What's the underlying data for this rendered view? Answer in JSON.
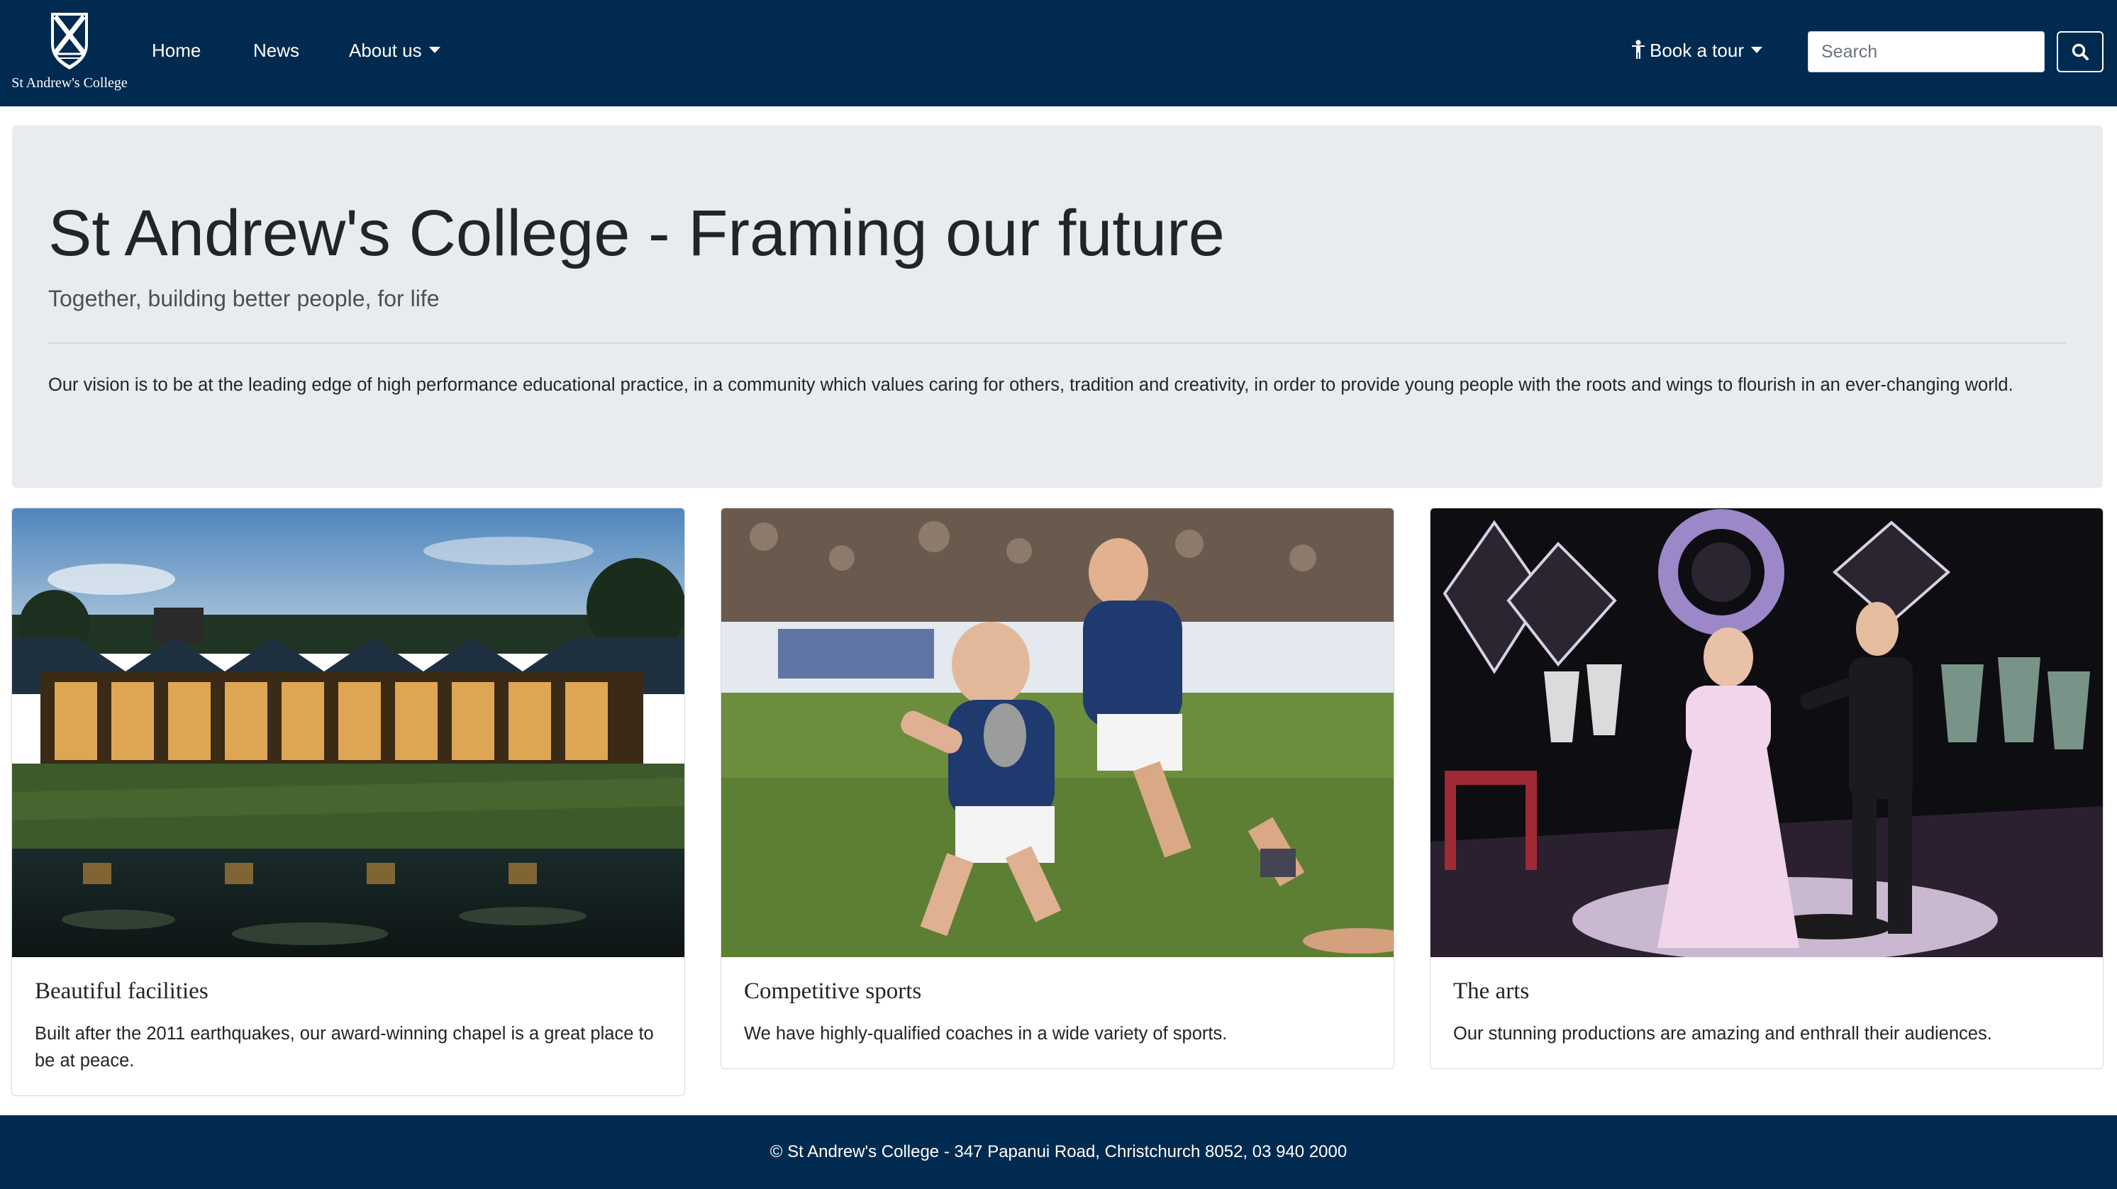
{
  "navbar": {
    "brand_text": "St Andrew's College",
    "links": [
      {
        "label": "Home"
      },
      {
        "label": "News"
      },
      {
        "label": "About us"
      }
    ],
    "book_tour_label": "Book a tour",
    "search_placeholder": "Search"
  },
  "jumbotron": {
    "title": "St Andrew's College - Framing our future",
    "lead": "Together, building better people, for life",
    "vision": "Our vision is to be at the leading edge of high performance educational practice, in a community which values caring for others, tradition and creativity, in order to provide young people with the roots and wings to flourish in an ever-changing world."
  },
  "cards": [
    {
      "title": "Beautiful facilities",
      "text": "Built after the 2011 earthquakes, our award-winning chapel is a great place to be at peace."
    },
    {
      "title": "Competitive sports",
      "text": "We have highly-qualified coaches in a wide variety of sports."
    },
    {
      "title": "The arts",
      "text": "Our stunning productions are amazing and enthrall their audiences."
    }
  ],
  "footer": {
    "text": "© St Andrew's College - 347 Papanui Road, Christchurch 8052, 03 940 2000"
  },
  "colors": {
    "navbar_bg": "#002a4f",
    "jumbotron_bg": "#e9ecef",
    "footer_bg": "#002a4f"
  }
}
